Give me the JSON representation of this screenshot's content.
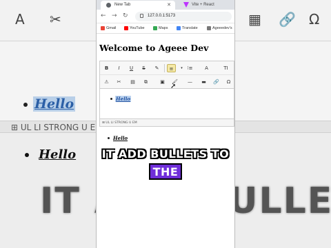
{
  "background": {
    "toolbar_icons": [
      "A",
      "✂",
      "📋",
      "▦",
      "🔗",
      "Ω"
    ],
    "statusbar": "⊞  UL  LI  STRONG  U  EM",
    "editor_text": "Hello",
    "output_text": "Hello",
    "caption": "IT ADD BULLETS TO"
  },
  "browser": {
    "tabs": [
      {
        "label": "New Tab",
        "active": true
      },
      {
        "label": "Vite + React",
        "active": false
      }
    ],
    "address": "127.0.0.1:5173",
    "bookmarks": [
      {
        "label": "Gmail",
        "color": "#ea4335"
      },
      {
        "label": "YouTube",
        "color": "#ff0000"
      },
      {
        "label": "Maps",
        "color": "#34a853"
      },
      {
        "label": "Translate",
        "color": "#4285f4"
      },
      {
        "label": "Ageeedev's",
        "color": "#777777"
      }
    ]
  },
  "page": {
    "title": "Welcome to Ageee Dev",
    "editor": {
      "toolbar_row1": [
        "B",
        "I",
        "U",
        "S",
        "✎",
        "≡",
        "⁝≡",
        "A",
        "TI"
      ],
      "toolbar_row2": [
        "⚠",
        "✂",
        "▤",
        "⧉",
        "▣",
        "🖌",
        "—",
        "▬",
        "🔗",
        "Ω"
      ],
      "content": "Hello",
      "status": "⊞  UL  LI  STRONG  U  EM"
    },
    "output": "Hello"
  },
  "caption": {
    "line1": "IT ADD BULLETS TO",
    "line2": "THE"
  },
  "colors": {
    "caption_highlight": "#6f2ed9",
    "selection": "#bcd3ef",
    "link_blue": "#1d4e9e"
  }
}
